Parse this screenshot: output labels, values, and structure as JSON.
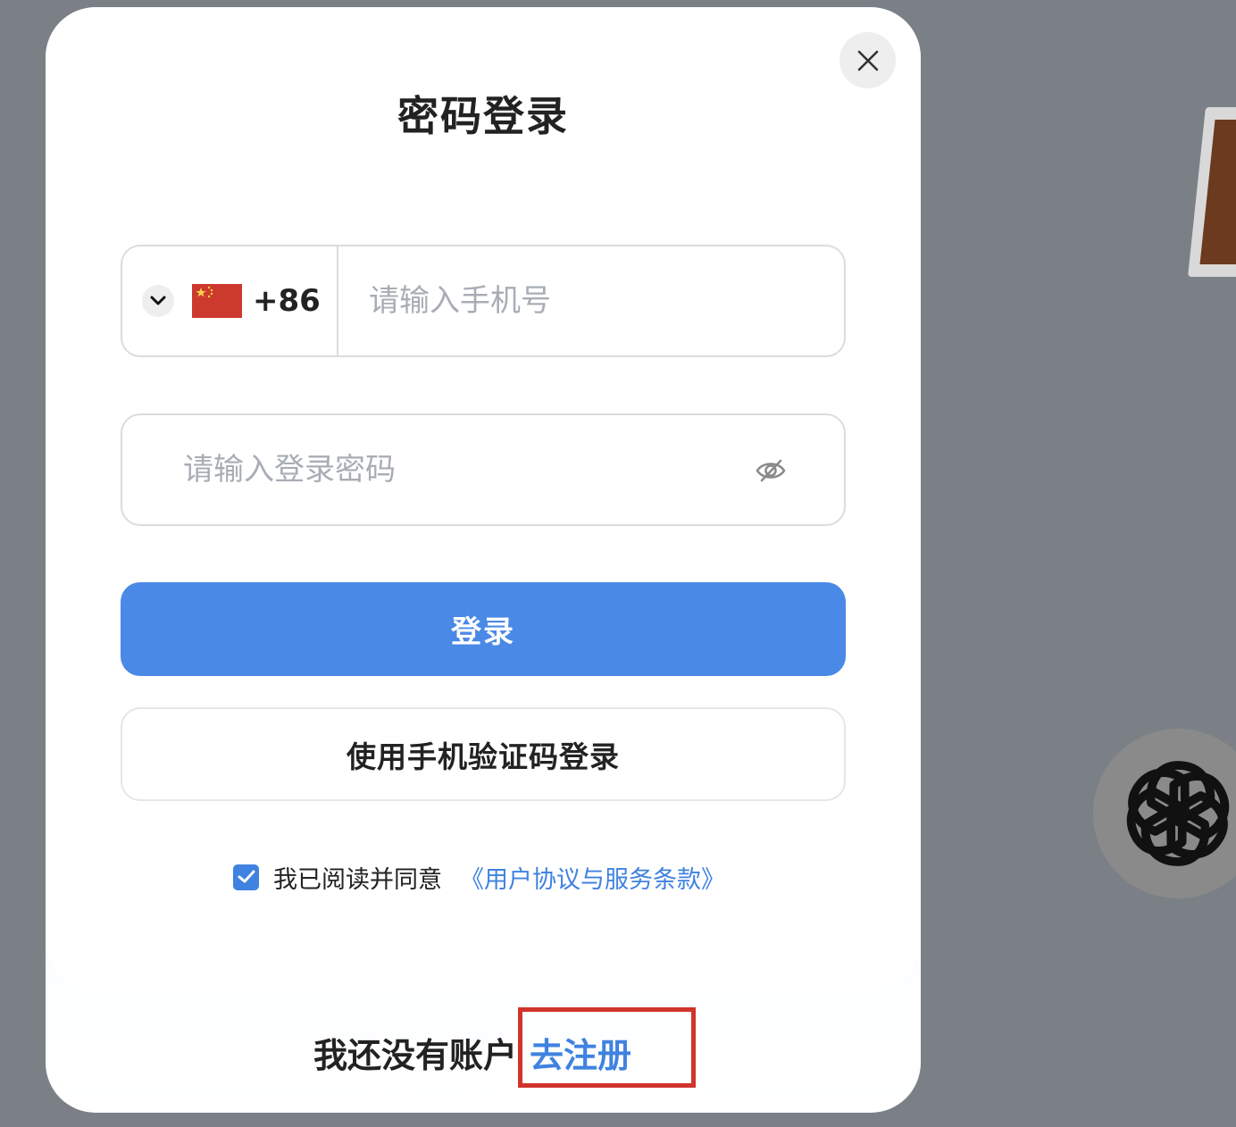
{
  "modal": {
    "title": "密码登录",
    "phone": {
      "dial_code": "+86",
      "placeholder": "请输入手机号",
      "value": ""
    },
    "password": {
      "placeholder": "请输入登录密码",
      "value": ""
    },
    "login_label": "登录",
    "sms_login_label": "使用手机验证码登录",
    "agreement": {
      "checked": true,
      "text": "我已阅读并同意",
      "link_text": "《用户协议与服务条款》"
    },
    "footer": {
      "no_account_text": "我还没有账户",
      "register_label": "去注册"
    }
  },
  "icons": {
    "close": "close-icon",
    "chevron": "chevron-down-icon",
    "flag": "china-flag-icon",
    "eye": "eye-off-icon",
    "check": "checkmark-icon",
    "bg_logo": "openai-logo-icon"
  },
  "colors": {
    "accent": "#4a89e6",
    "link": "#3f82e0",
    "highlight": "#d0342c",
    "backdrop": "#7b8087"
  }
}
